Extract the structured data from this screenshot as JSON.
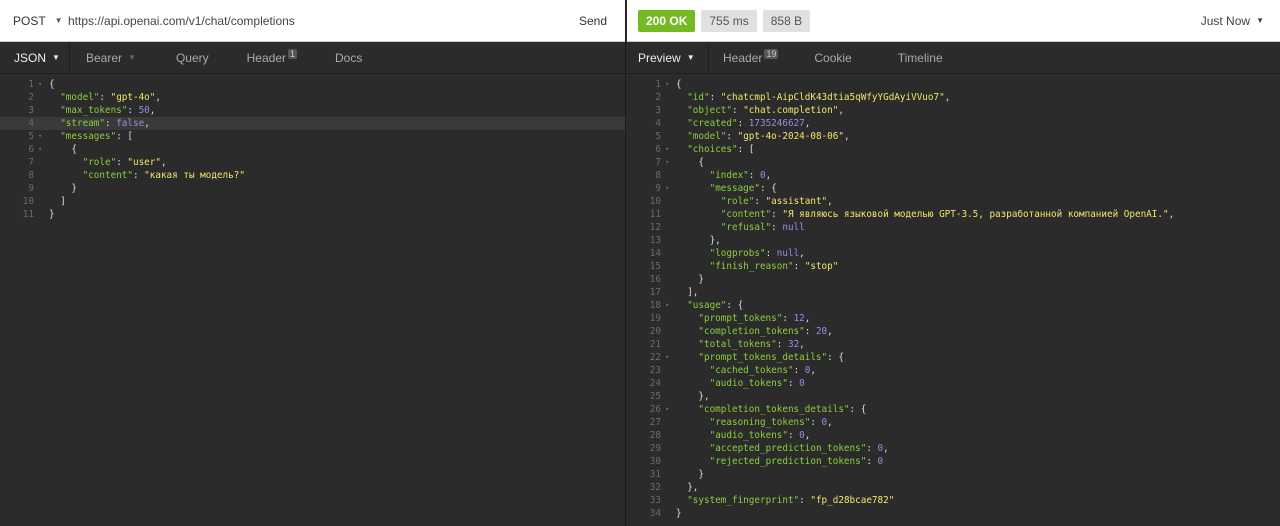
{
  "request": {
    "method": "POST",
    "url": "https://api.openai.com/v1/chat/completions",
    "send_label": "Send",
    "tabs": [
      {
        "label": "JSON",
        "active": true
      },
      {
        "label": "Bearer"
      },
      {
        "label": "Query"
      },
      {
        "label": "Header",
        "badge": "1"
      },
      {
        "label": "Docs"
      }
    ],
    "body_lines": [
      {
        "n": "1",
        "f": "▾",
        "t": [
          [
            "p",
            "{"
          ]
        ]
      },
      {
        "n": "2",
        "f": "",
        "t": [
          [
            "p",
            "  "
          ],
          [
            "k",
            "\"model\""
          ],
          [
            "p",
            ": "
          ],
          [
            "s",
            "\"gpt-4o\""
          ],
          [
            "p",
            ","
          ]
        ]
      },
      {
        "n": "3",
        "f": "",
        "t": [
          [
            "p",
            "  "
          ],
          [
            "k",
            "\"max_tokens\""
          ],
          [
            "p",
            ": "
          ],
          [
            "n",
            "50"
          ],
          [
            "p",
            ","
          ]
        ]
      },
      {
        "n": "4",
        "f": "",
        "hl": true,
        "t": [
          [
            "p",
            "  "
          ],
          [
            "k",
            "\"stream\""
          ],
          [
            "p",
            ": "
          ],
          [
            "n",
            "false"
          ],
          [
            "p",
            ","
          ]
        ]
      },
      {
        "n": "5",
        "f": "▾",
        "t": [
          [
            "p",
            "  "
          ],
          [
            "k",
            "\"messages\""
          ],
          [
            "p",
            ": ["
          ]
        ]
      },
      {
        "n": "6",
        "f": "▾",
        "t": [
          [
            "p",
            "    {"
          ]
        ]
      },
      {
        "n": "7",
        "f": "",
        "t": [
          [
            "p",
            "      "
          ],
          [
            "k",
            "\"role\""
          ],
          [
            "p",
            ": "
          ],
          [
            "s",
            "\"user\""
          ],
          [
            "p",
            ","
          ]
        ]
      },
      {
        "n": "8",
        "f": "",
        "t": [
          [
            "p",
            "      "
          ],
          [
            "k",
            "\"content\""
          ],
          [
            "p",
            ": "
          ],
          [
            "s",
            "\"какая ты модель?\""
          ]
        ]
      },
      {
        "n": "9",
        "f": "",
        "t": [
          [
            "p",
            "    }"
          ]
        ]
      },
      {
        "n": "10",
        "f": "",
        "t": [
          [
            "p",
            "  ]"
          ]
        ]
      },
      {
        "n": "11",
        "f": "",
        "t": [
          [
            "p",
            "}"
          ]
        ]
      }
    ]
  },
  "response": {
    "status": "200 OK",
    "time": "755 ms",
    "size": "858 B",
    "when": "Just Now",
    "colors": {
      "ok": "#75ba24"
    },
    "tabs": [
      {
        "label": "Preview",
        "active": true
      },
      {
        "label": "Header",
        "badge": "19"
      },
      {
        "label": "Cookie"
      },
      {
        "label": "Timeline"
      }
    ],
    "body_lines": [
      {
        "n": "1",
        "f": "▾",
        "t": [
          [
            "p",
            "{"
          ]
        ]
      },
      {
        "n": "2",
        "f": "",
        "t": [
          [
            "p",
            "  "
          ],
          [
            "k",
            "\"id\""
          ],
          [
            "p",
            ": "
          ],
          [
            "s",
            "\"chatcmpl-AipCldK43dtia5qWfyYGdAyiVVuo7\""
          ],
          [
            "p",
            ","
          ]
        ]
      },
      {
        "n": "3",
        "f": "",
        "t": [
          [
            "p",
            "  "
          ],
          [
            "k",
            "\"object\""
          ],
          [
            "p",
            ": "
          ],
          [
            "s",
            "\"chat.completion\""
          ],
          [
            "p",
            ","
          ]
        ]
      },
      {
        "n": "4",
        "f": "",
        "t": [
          [
            "p",
            "  "
          ],
          [
            "k",
            "\"created\""
          ],
          [
            "p",
            ": "
          ],
          [
            "n",
            "1735246627"
          ],
          [
            "p",
            ","
          ]
        ]
      },
      {
        "n": "5",
        "f": "",
        "t": [
          [
            "p",
            "  "
          ],
          [
            "k",
            "\"model\""
          ],
          [
            "p",
            ": "
          ],
          [
            "s",
            "\"gpt-4o-2024-08-06\""
          ],
          [
            "p",
            ","
          ]
        ]
      },
      {
        "n": "6",
        "f": "▾",
        "t": [
          [
            "p",
            "  "
          ],
          [
            "k",
            "\"choices\""
          ],
          [
            "p",
            ": ["
          ]
        ]
      },
      {
        "n": "7",
        "f": "▾",
        "t": [
          [
            "p",
            "    {"
          ]
        ]
      },
      {
        "n": "8",
        "f": "",
        "t": [
          [
            "p",
            "      "
          ],
          [
            "k",
            "\"index\""
          ],
          [
            "p",
            ": "
          ],
          [
            "n",
            "0"
          ],
          [
            "p",
            ","
          ]
        ]
      },
      {
        "n": "9",
        "f": "▾",
        "t": [
          [
            "p",
            "      "
          ],
          [
            "k",
            "\"message\""
          ],
          [
            "p",
            ": {"
          ]
        ]
      },
      {
        "n": "10",
        "f": "",
        "t": [
          [
            "p",
            "        "
          ],
          [
            "k",
            "\"role\""
          ],
          [
            "p",
            ": "
          ],
          [
            "s",
            "\"assistant\""
          ],
          [
            "p",
            ","
          ]
        ]
      },
      {
        "n": "11",
        "f": "",
        "t": [
          [
            "p",
            "        "
          ],
          [
            "k",
            "\"content\""
          ],
          [
            "p",
            ": "
          ],
          [
            "s",
            "\"Я являюсь языковой моделью GPT-3.5, разработанной компанией OpenAI.\""
          ],
          [
            "p",
            ","
          ]
        ]
      },
      {
        "n": "12",
        "f": "",
        "t": [
          [
            "p",
            "        "
          ],
          [
            "k",
            "\"refusal\""
          ],
          [
            "p",
            ": "
          ],
          [
            "n",
            "null"
          ]
        ]
      },
      {
        "n": "13",
        "f": "",
        "t": [
          [
            "p",
            "      },"
          ]
        ]
      },
      {
        "n": "14",
        "f": "",
        "t": [
          [
            "p",
            "      "
          ],
          [
            "k",
            "\"logprobs\""
          ],
          [
            "p",
            ": "
          ],
          [
            "n",
            "null"
          ],
          [
            "p",
            ","
          ]
        ]
      },
      {
        "n": "15",
        "f": "",
        "t": [
          [
            "p",
            "      "
          ],
          [
            "k",
            "\"finish_reason\""
          ],
          [
            "p",
            ": "
          ],
          [
            "s",
            "\"stop\""
          ]
        ]
      },
      {
        "n": "16",
        "f": "",
        "t": [
          [
            "p",
            "    }"
          ]
        ]
      },
      {
        "n": "17",
        "f": "",
        "t": [
          [
            "p",
            "  ],"
          ]
        ]
      },
      {
        "n": "18",
        "f": "▾",
        "t": [
          [
            "p",
            "  "
          ],
          [
            "k",
            "\"usage\""
          ],
          [
            "p",
            ": {"
          ]
        ]
      },
      {
        "n": "19",
        "f": "",
        "t": [
          [
            "p",
            "    "
          ],
          [
            "k",
            "\"prompt_tokens\""
          ],
          [
            "p",
            ": "
          ],
          [
            "n",
            "12"
          ],
          [
            "p",
            ","
          ]
        ]
      },
      {
        "n": "20",
        "f": "",
        "t": [
          [
            "p",
            "    "
          ],
          [
            "k",
            "\"completion_tokens\""
          ],
          [
            "p",
            ": "
          ],
          [
            "n",
            "20"
          ],
          [
            "p",
            ","
          ]
        ]
      },
      {
        "n": "21",
        "f": "",
        "t": [
          [
            "p",
            "    "
          ],
          [
            "k",
            "\"total_tokens\""
          ],
          [
            "p",
            ": "
          ],
          [
            "n",
            "32"
          ],
          [
            "p",
            ","
          ]
        ]
      },
      {
        "n": "22",
        "f": "▾",
        "t": [
          [
            "p",
            "    "
          ],
          [
            "k",
            "\"prompt_tokens_details\""
          ],
          [
            "p",
            ": {"
          ]
        ]
      },
      {
        "n": "23",
        "f": "",
        "t": [
          [
            "p",
            "      "
          ],
          [
            "k",
            "\"cached_tokens\""
          ],
          [
            "p",
            ": "
          ],
          [
            "n",
            "0"
          ],
          [
            "p",
            ","
          ]
        ]
      },
      {
        "n": "24",
        "f": "",
        "t": [
          [
            "p",
            "      "
          ],
          [
            "k",
            "\"audio_tokens\""
          ],
          [
            "p",
            ": "
          ],
          [
            "n",
            "0"
          ]
        ]
      },
      {
        "n": "25",
        "f": "",
        "t": [
          [
            "p",
            "    },"
          ]
        ]
      },
      {
        "n": "26",
        "f": "▾",
        "t": [
          [
            "p",
            "    "
          ],
          [
            "k",
            "\"completion_tokens_details\""
          ],
          [
            "p",
            ": {"
          ]
        ]
      },
      {
        "n": "27",
        "f": "",
        "t": [
          [
            "p",
            "      "
          ],
          [
            "k",
            "\"reasoning_tokens\""
          ],
          [
            "p",
            ": "
          ],
          [
            "n",
            "0"
          ],
          [
            "p",
            ","
          ]
        ]
      },
      {
        "n": "28",
        "f": "",
        "t": [
          [
            "p",
            "      "
          ],
          [
            "k",
            "\"audio_tokens\""
          ],
          [
            "p",
            ": "
          ],
          [
            "n",
            "0"
          ],
          [
            "p",
            ","
          ]
        ]
      },
      {
        "n": "29",
        "f": "",
        "t": [
          [
            "p",
            "      "
          ],
          [
            "k",
            "\"accepted_prediction_tokens\""
          ],
          [
            "p",
            ": "
          ],
          [
            "n",
            "0"
          ],
          [
            "p",
            ","
          ]
        ]
      },
      {
        "n": "30",
        "f": "",
        "t": [
          [
            "p",
            "      "
          ],
          [
            "k",
            "\"rejected_prediction_tokens\""
          ],
          [
            "p",
            ": "
          ],
          [
            "n",
            "0"
          ]
        ]
      },
      {
        "n": "31",
        "f": "",
        "t": [
          [
            "p",
            "    }"
          ]
        ]
      },
      {
        "n": "32",
        "f": "",
        "t": [
          [
            "p",
            "  },"
          ]
        ]
      },
      {
        "n": "33",
        "f": "",
        "t": [
          [
            "p",
            "  "
          ],
          [
            "k",
            "\"system_fingerprint\""
          ],
          [
            "p",
            ": "
          ],
          [
            "s",
            "\"fp_d28bcae782\""
          ]
        ]
      },
      {
        "n": "34",
        "f": "",
        "t": [
          [
            "p",
            "}"
          ]
        ]
      }
    ]
  }
}
